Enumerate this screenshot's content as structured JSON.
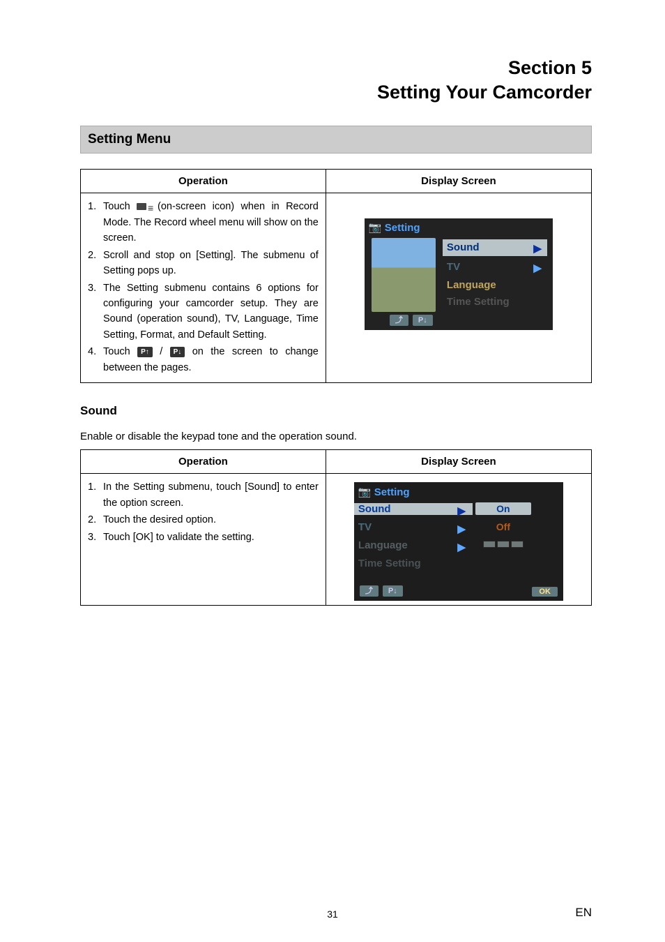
{
  "header": {
    "section_line": "Section 5",
    "title_line": "Setting Your Camcorder"
  },
  "menu_bar": "Setting Menu",
  "table1": {
    "head_operation": "Operation",
    "head_display": "Display Screen",
    "ops": [
      {
        "num": "1.",
        "pre": "Touch ",
        "icon": "menu",
        "post": "(on-screen icon) when in Record Mode. The Record wheel menu will show on the screen."
      },
      {
        "num": "2.",
        "text": "Scroll and stop on [Setting]. The submenu of Setting pops up."
      },
      {
        "num": "3.",
        "text": "The Setting submenu contains 6 options for configuring your camcorder setup. They are Sound (operation sound), TV, Language, Time Setting, Format, and Default Setting."
      },
      {
        "num": "4.",
        "pre": "Touch ",
        "icon": "pupdown",
        "post": "on the screen to change between the pages."
      }
    ]
  },
  "screen1": {
    "title": "Setting",
    "items": [
      "Sound",
      "TV",
      "Language",
      "Time Setting"
    ],
    "page_down": "P↓"
  },
  "sound_heading": "Sound",
  "sound_desc": "Enable or disable the keypad tone and the operation sound.",
  "table2": {
    "head_operation": "Operation",
    "head_display": "Display Screen",
    "ops": [
      {
        "num": "1.",
        "text": "In the Setting submenu, touch [Sound] to enter the option screen."
      },
      {
        "num": "2.",
        "text": "Touch the desired option."
      },
      {
        "num": "3.",
        "text": "Touch [OK] to validate the setting."
      }
    ]
  },
  "screen2": {
    "title": "Setting",
    "rows": [
      {
        "label": "Sound",
        "value": "On"
      },
      {
        "label": "TV",
        "value": "Off"
      },
      {
        "label": "Language",
        "value": ""
      },
      {
        "label": "Time Setting",
        "value": ""
      }
    ],
    "page_down": "P↓",
    "ok": "OK"
  },
  "page_number": "31",
  "lang": "EN",
  "icons": {
    "p_up": "P↑",
    "p_down": "P↓"
  }
}
